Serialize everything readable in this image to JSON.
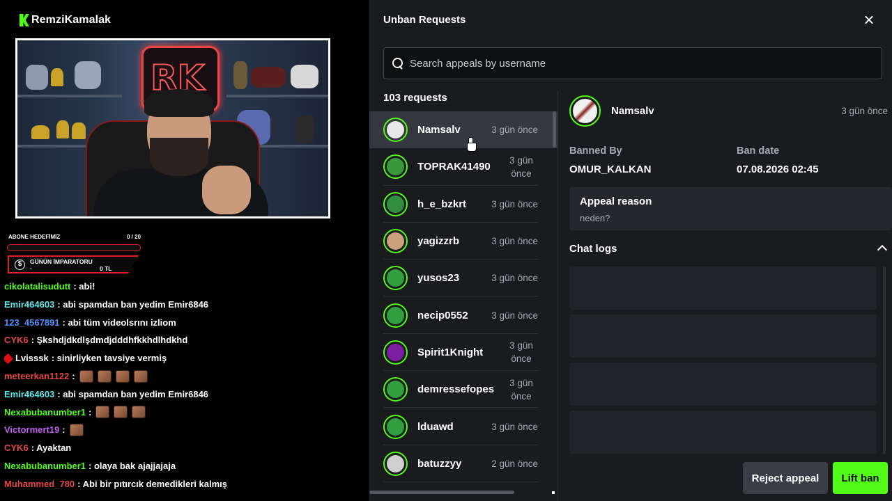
{
  "stream": {
    "channel_name": "RemziKamalak",
    "cam_sign_text": "RK",
    "goal_label": "ABONE HEDEFİMİZ",
    "goal_count": "0 / 20",
    "goal_progress": 0,
    "emperor_title": "GÜNÜN İMPARATORU",
    "emperor_name": "-",
    "emperor_amount": "0 TL",
    "chat": [
      {
        "user": "cikolatalisudutt",
        "color": "#53fc18",
        "message": ": abi!",
        "emotes": 0
      },
      {
        "user": "Emir464603",
        "color": "#5ee8e8",
        "message": ": abi spamdan ban yedim Emir6846",
        "emotes": 0
      },
      {
        "user": "123_4567891",
        "color": "#4f8ff7",
        "message": ": abi tüm videolsrını izliom",
        "emotes": 0
      },
      {
        "user": "CYK6",
        "color": "#e64545",
        "message": ": Şkshdjdkdlşdmdjdddhfkkhdlhdkhd",
        "emotes": 0
      },
      {
        "user": "Lvisssk",
        "color": "#ffffff",
        "message": ": sinirliyken tavsiye vermiş",
        "emotes": 0,
        "badge": true
      },
      {
        "user": "meteerkan1122",
        "color": "#e64545",
        "message": ":",
        "emotes": 4
      },
      {
        "user": "Emir464603",
        "color": "#5ee8e8",
        "message": ": abi spamdan ban yedim Emir6846",
        "emotes": 0
      },
      {
        "user": "Nexabubanumber1",
        "color": "#53fc18",
        "message": ":",
        "emotes": 3
      },
      {
        "user": "Victormert19",
        "color": "#c15ef2",
        "message": ":",
        "emotes": 1
      },
      {
        "user": "CYK6",
        "color": "#e64545",
        "message": ": Ayaktan",
        "emotes": 0
      },
      {
        "user": "Nexabubanumber1",
        "color": "#53fc18",
        "message": ": olaya bak ajajjajaja",
        "emotes": 0
      },
      {
        "user": "Muhammed_780",
        "color": "#e64545",
        "message": ": Abi bir pıtırcık demedikleri kalmış",
        "emotes": 0
      }
    ]
  },
  "panel": {
    "title": "Unban Requests",
    "search_placeholder": "Search appeals by username",
    "request_count": "103 requests",
    "requests": [
      {
        "username": "Namsalv",
        "time": "3 gün önce",
        "selected": true,
        "avatar": "#e8e8e8"
      },
      {
        "username": "TOPRAK41490",
        "time": "3 gün önce",
        "wrap": true,
        "avatar": "#3a9a3a"
      },
      {
        "username": "h_e_bzkrt",
        "time": "3 gün önce",
        "avatar": "#2f8f3f"
      },
      {
        "username": "yagizzrb",
        "time": "3 gün önce",
        "avatar": "#c9a27c"
      },
      {
        "username": "yusos23",
        "time": "3 gün önce",
        "avatar": "#2f9f3f"
      },
      {
        "username": "necip0552",
        "time": "3 gün önce",
        "avatar": "#2f9f3f"
      },
      {
        "username": "Spirit1Knight",
        "time": "3 gün önce",
        "wrap": true,
        "avatar": "#7a1fa0"
      },
      {
        "username": "demressefopes",
        "time": "3 gün önce",
        "wrap": true,
        "avatar": "#2f9f3f"
      },
      {
        "username": "lduawd",
        "time": "3 gün önce",
        "avatar": "#2f9f3f"
      },
      {
        "username": "batuzzyy",
        "time": "2 gün önce",
        "avatar": "#cfcfcf"
      }
    ],
    "detail": {
      "username": "Namsalv",
      "time": "3 gün önce",
      "banned_by_label": "Banned By",
      "banned_by": "OMUR_KALKAN",
      "ban_date_label": "Ban date",
      "ban_date": "07.08.2026 02:45",
      "appeal_reason_label": "Appeal reason",
      "appeal_reason": "neden?",
      "chat_logs_label": "Chat logs"
    },
    "reject_label": "Reject appeal",
    "lift_label": "Lift ban"
  }
}
